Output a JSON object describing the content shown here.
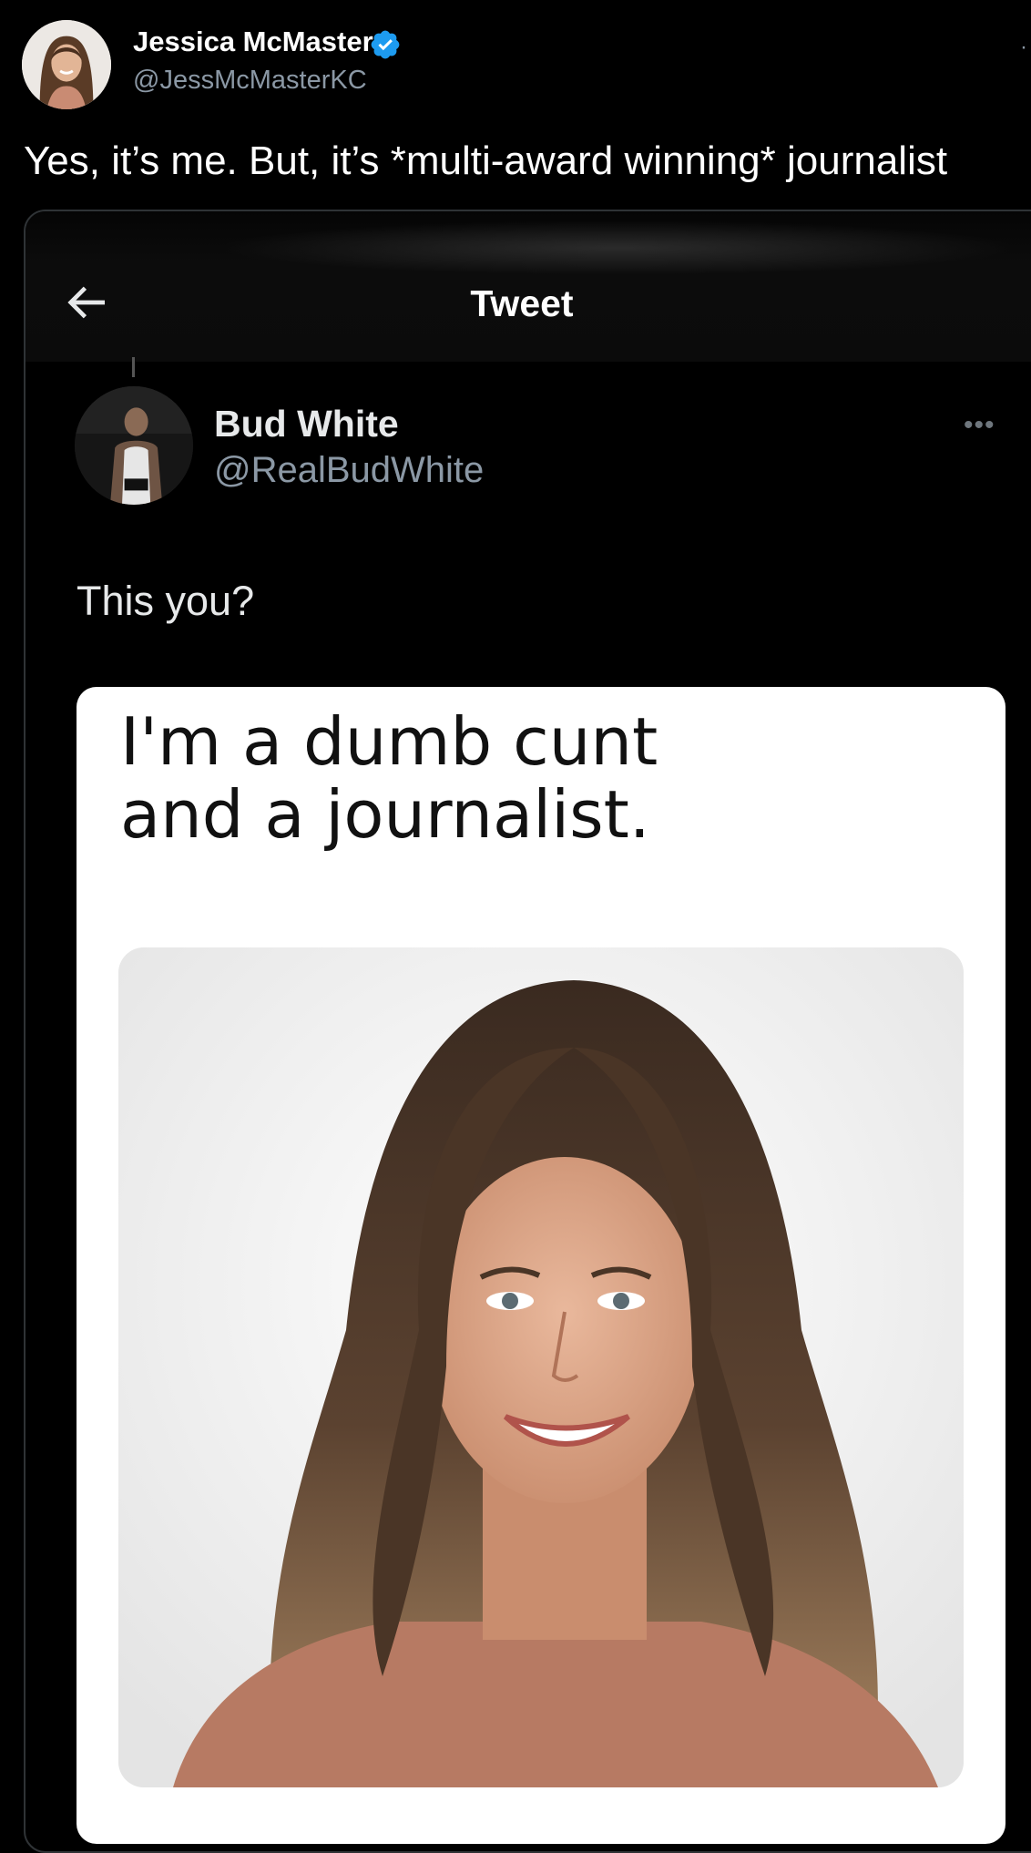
{
  "tweet": {
    "author_name": "Jessica McMaster",
    "author_handle": "@JessMcMasterKC",
    "verified": true,
    "text": "Yes, it’s me. But, it’s *multi-award winning* journalist"
  },
  "quoted_screenshot": {
    "topbar_title": "Tweet",
    "author_name": "Bud White",
    "author_handle": "@RealBudWhite",
    "text": "This you?",
    "meme": {
      "caption_line1": "I'm a dumb cunt",
      "caption_line2": "and a journalist."
    }
  },
  "icons": {
    "verified": "verified-badge-icon",
    "back": "back-arrow-icon",
    "more": "more-dots-icon"
  },
  "colors": {
    "background": "#000000",
    "verified_blue": "#1d9bf0",
    "secondary_text": "#8b98a5",
    "meme_bg": "#ffffff"
  }
}
